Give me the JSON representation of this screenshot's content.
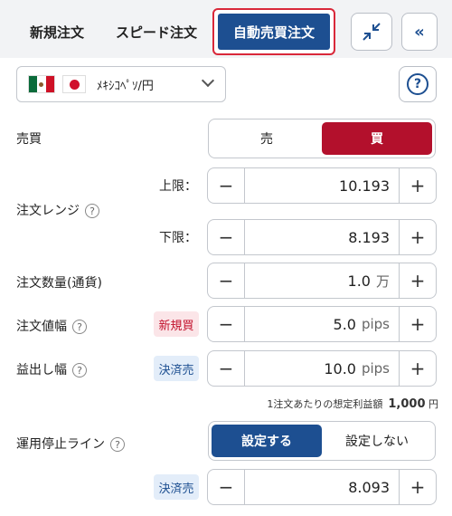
{
  "tabs": {
    "new_order": "新規注文",
    "speed_order": "スピード注文",
    "auto_order": "自動売買注文"
  },
  "header_icons": {
    "shrink": "shrink-icon",
    "collapse": "double-chevron-left-icon"
  },
  "currency_pair": {
    "label": "ﾒｷｼｺﾍﾟｿ/円",
    "flags": [
      "mexico-flag",
      "japan-flag"
    ]
  },
  "help_icon": "?",
  "side": {
    "label": "売買",
    "sell": "売",
    "buy": "買",
    "selected": "buy"
  },
  "order_range": {
    "label": "注文レンジ",
    "upper_label": "上限：",
    "upper_value": "10.193",
    "lower_label": "下限：",
    "lower_value": "8.193"
  },
  "quantity": {
    "label": "注文数量(通貨)",
    "value": "1.0",
    "unit": "万"
  },
  "order_width": {
    "label": "注文値幅",
    "tag": "新規買",
    "value": "5.0",
    "unit": "pips"
  },
  "profit_width": {
    "label": "益出し幅",
    "tag": "決済売",
    "value": "10.0",
    "unit": "pips"
  },
  "expected_profit": {
    "label": "1注文あたりの想定利益額",
    "value": "1,000",
    "unit": "円"
  },
  "stop_line": {
    "label": "運用停止ライン",
    "on": "設定する",
    "off": "設定しない",
    "selected": "on",
    "tag": "決済売",
    "value": "8.093"
  },
  "stepper": {
    "minus": "−",
    "plus": "+"
  },
  "colors": {
    "brand_blue": "#1d4f91",
    "buy_red": "#b3102c",
    "highlight_red": "#d9283a"
  }
}
